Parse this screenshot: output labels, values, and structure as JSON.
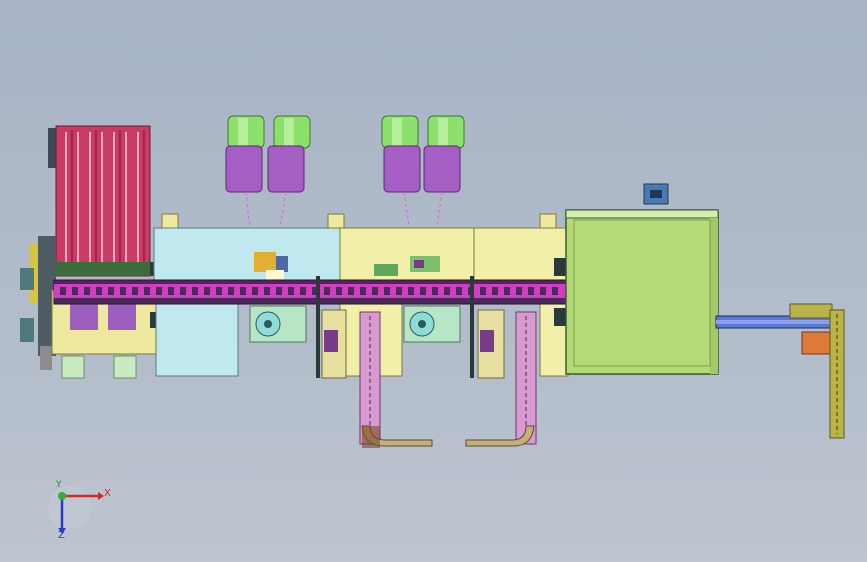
{
  "triad": {
    "x_label": "X",
    "y_label": "Y",
    "z_label": "Z"
  },
  "colors": {
    "background_top": "#a7b4c6",
    "background_bottom": "#bcc4cf",
    "feeder_magenta": "#d43c6a",
    "panel_cyan": "#bfe8ef",
    "panel_yellow": "#f2f0a8",
    "box_green": "#b4da78",
    "lamp_green": "#8de06c",
    "lamp_purple": "#a55fc4",
    "chain_magenta": "#d23ec0",
    "track_pink": "#d89ad0",
    "arm_olive": "#b9b34a"
  },
  "components": [
    "vibratory-feeder",
    "indexing-conveyor",
    "camera-lamp-1",
    "camera-lamp-2",
    "camera-lamp-3",
    "camera-lamp-4",
    "station-panel-1",
    "station-panel-2",
    "station-panel-3",
    "output-box",
    "output-arm",
    "reject-chute-1",
    "reject-chute-2"
  ]
}
